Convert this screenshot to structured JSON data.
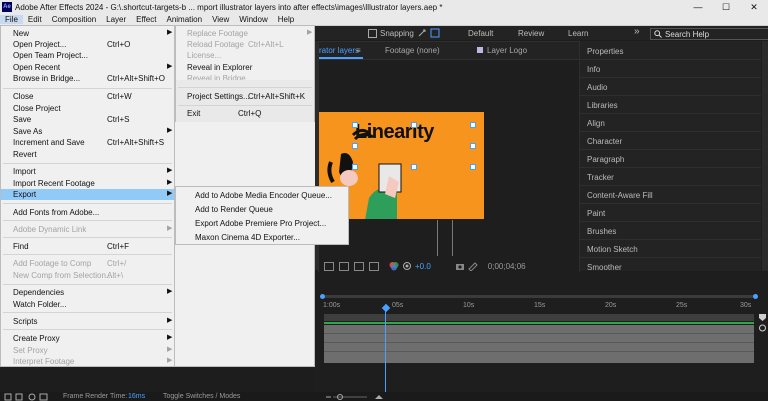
{
  "window": {
    "title": "Adobe After Effects 2024 - G:\\.shortcut-targets-b ... mport illustrator layers into after effects\\images\\Illustrator layers.aep *",
    "app_icon": "Ae",
    "minimize": "—",
    "maximize": "☐",
    "close": "✕"
  },
  "menubar": [
    "File",
    "Edit",
    "Composition",
    "Layer",
    "Effect",
    "Animation",
    "View",
    "Window",
    "Help"
  ],
  "toolbar": {
    "snapping": "Snapping",
    "workspaces": [
      "Default",
      "Review",
      "Learn"
    ],
    "overflow": "»",
    "search_placeholder": "Search Help"
  },
  "comp_panel": {
    "tabs": [
      "rator layers",
      "Footage  (none)",
      "Layer  Logo"
    ],
    "tab_menu": "≡",
    "logo_text": "Linearity",
    "color_label": "+0.0",
    "timecode": "0;00;04;06"
  },
  "right_panel": [
    "Properties",
    "Info",
    "Audio",
    "Libraries",
    "Align",
    "Character",
    "Paragraph",
    "Tracker",
    "Content-Aware Fill",
    "Paint",
    "Brushes",
    "Motion Sketch",
    "Smoother"
  ],
  "timeline": {
    "ticks": [
      "1:00s",
      "05s",
      "10s",
      "15s",
      "20s",
      "25s",
      "30s"
    ]
  },
  "statusbar": {
    "frame_render_label": "Frame Render Time:",
    "frame_render_value": "16ms",
    "toggle": "Toggle Switches / Modes"
  },
  "file_menu": [
    {
      "label": "New",
      "shortcut": "",
      "submenu": true,
      "disabled": false
    },
    {
      "label": "Open Project...",
      "shortcut": "Ctrl+O",
      "submenu": false,
      "disabled": false
    },
    {
      "label": "Open Team Project...",
      "shortcut": "",
      "submenu": false,
      "disabled": false
    },
    {
      "label": "Open Recent",
      "shortcut": "",
      "submenu": true,
      "disabled": false
    },
    {
      "label": "Browse in Bridge...",
      "shortcut": "Ctrl+Alt+Shift+O",
      "submenu": false,
      "disabled": false
    },
    {
      "label": "Close",
      "shortcut": "Ctrl+W",
      "submenu": false,
      "disabled": false
    },
    {
      "label": "Close Project",
      "shortcut": "",
      "submenu": false,
      "disabled": false
    },
    {
      "label": "Save",
      "shortcut": "Ctrl+S",
      "submenu": false,
      "disabled": false
    },
    {
      "label": "Save As",
      "shortcut": "",
      "submenu": true,
      "disabled": false
    },
    {
      "label": "Increment and Save",
      "shortcut": "Ctrl+Alt+Shift+S",
      "submenu": false,
      "disabled": false
    },
    {
      "label": "Revert",
      "shortcut": "",
      "submenu": false,
      "disabled": false
    },
    {
      "label": "Import",
      "shortcut": "",
      "submenu": true,
      "disabled": false
    },
    {
      "label": "Import Recent Footage",
      "shortcut": "",
      "submenu": true,
      "disabled": false
    },
    {
      "label": "Export",
      "shortcut": "",
      "submenu": true,
      "disabled": false
    },
    {
      "label": "Add Fonts from Adobe...",
      "shortcut": "",
      "submenu": false,
      "disabled": false
    },
    {
      "label": "Adobe Dynamic Link",
      "shortcut": "",
      "submenu": true,
      "disabled": true
    },
    {
      "label": "Find",
      "shortcut": "Ctrl+F",
      "submenu": false,
      "disabled": false
    },
    {
      "label": "Add Footage to Comp",
      "shortcut": "Ctrl+/",
      "submenu": false,
      "disabled": true
    },
    {
      "label": "New Comp from Selection...",
      "shortcut": "Alt+\\",
      "submenu": false,
      "disabled": true
    },
    {
      "label": "Dependencies",
      "shortcut": "",
      "submenu": true,
      "disabled": false
    },
    {
      "label": "Watch Folder...",
      "shortcut": "",
      "submenu": false,
      "disabled": false
    },
    {
      "label": "Scripts",
      "shortcut": "",
      "submenu": true,
      "disabled": false
    },
    {
      "label": "Create Proxy",
      "shortcut": "",
      "submenu": true,
      "disabled": false
    },
    {
      "label": "Set Proxy",
      "shortcut": "",
      "submenu": true,
      "disabled": true
    },
    {
      "label": "Interpret Footage",
      "shortcut": "",
      "submenu": true,
      "disabled": true
    }
  ],
  "recent_menu": [
    {
      "label": "Replace Footage",
      "shortcut": "",
      "submenu": true,
      "disabled": true
    },
    {
      "label": "Reload Footage",
      "shortcut": "Ctrl+Alt+L",
      "submenu": false,
      "disabled": true
    },
    {
      "label": "License...",
      "shortcut": "",
      "submenu": false,
      "disabled": true
    },
    {
      "label": "Reveal in Explorer",
      "shortcut": "",
      "submenu": false,
      "disabled": false
    },
    {
      "label": "Reveal in Bridge",
      "shortcut": "",
      "submenu": false,
      "disabled": true
    },
    {
      "label": "Project Settings...",
      "shortcut": "Ctrl+Alt+Shift+K",
      "submenu": false,
      "disabled": false
    },
    {
      "label": "Exit",
      "shortcut": "Ctrl+Q",
      "submenu": false,
      "disabled": false
    }
  ],
  "export_menu": [
    {
      "label": "Add to Adobe Media Encoder Queue..."
    },
    {
      "label": "Add to Render Queue"
    },
    {
      "label": "Export Adobe Premiere Pro Project..."
    },
    {
      "label": "Maxon Cinema 4D Exporter..."
    }
  ]
}
